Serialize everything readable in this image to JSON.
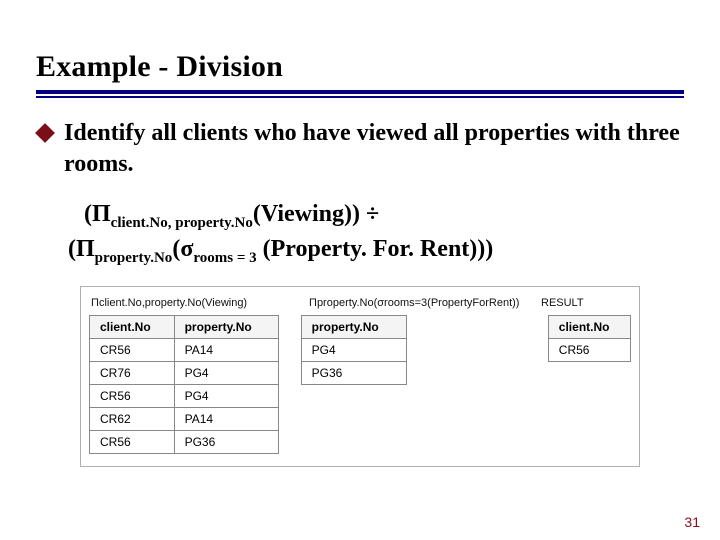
{
  "title": "Example - Division",
  "prompt": "Identify all clients who have viewed all properties with three rooms.",
  "formula": {
    "line1": {
      "open": "(",
      "piSub1": "client.No, property.No",
      "rel1": "(Viewing)) ",
      "div": "÷"
    },
    "line2": {
      "open": "(",
      "piSub2": "property.No",
      "sigSub": "rooms = 3",
      "tail": " (Property. For. Rent)))"
    },
    "pi": "Π",
    "sigma": "σ"
  },
  "tables": {
    "header_a": "Πclient.No,property.No(Viewing)",
    "header_b": "Πproperty.No(σrooms=3(PropertyForRent))",
    "header_c": "RESULT",
    "t1": {
      "h1": "client.No",
      "h2": "property.No",
      "rows": [
        {
          "c": "CR56",
          "p": "PA14"
        },
        {
          "c": "CR76",
          "p": "PG4"
        },
        {
          "c": "CR56",
          "p": "PG4"
        },
        {
          "c": "CR62",
          "p": "PA14"
        },
        {
          "c": "CR56",
          "p": "PG36"
        }
      ]
    },
    "t2": {
      "h1": "property.No",
      "rows": [
        {
          "p": "PG4"
        },
        {
          "p": "PG36"
        }
      ]
    },
    "t3": {
      "h1": "client.No",
      "rows": [
        {
          "c": "CR56"
        }
      ]
    }
  },
  "pagenum": "31"
}
